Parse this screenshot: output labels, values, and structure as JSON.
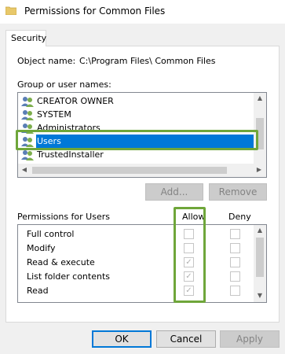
{
  "window": {
    "title": "Permissions for Common Files",
    "title_icon": "folder-icon"
  },
  "tabs": [
    {
      "label": "Security",
      "active": true
    }
  ],
  "object": {
    "label": "Object name:",
    "value": "C:\\Program Files\\ Common Files"
  },
  "groups": {
    "label": "Group or user names:",
    "items": [
      {
        "name": "CREATOR OWNER",
        "icon": "users-icon",
        "selected": false
      },
      {
        "name": "SYSTEM",
        "icon": "users-icon",
        "selected": false
      },
      {
        "name": "Administrators",
        "icon": "users-icon",
        "selected": false
      },
      {
        "name": "Users",
        "icon": "users-icon",
        "selected": true
      },
      {
        "name": "TrustedInstaller",
        "icon": "users-icon",
        "selected": false
      }
    ],
    "add_label": "Add...",
    "remove_label": "Remove"
  },
  "permissions": {
    "label": "Permissions for Users",
    "allow_label": "Allow",
    "deny_label": "Deny",
    "rows": [
      {
        "name": "Full control",
        "allow": false,
        "deny": false
      },
      {
        "name": "Modify",
        "allow": false,
        "deny": false
      },
      {
        "name": "Read & execute",
        "allow": true,
        "deny": false
      },
      {
        "name": "List folder contents",
        "allow": true,
        "deny": false
      },
      {
        "name": "Read",
        "allow": true,
        "deny": false
      }
    ]
  },
  "footer": {
    "ok_label": "OK",
    "cancel_label": "Cancel",
    "apply_label": "Apply"
  },
  "colors": {
    "selection": "#0078d7",
    "highlight_annotation": "#6fa63a"
  }
}
